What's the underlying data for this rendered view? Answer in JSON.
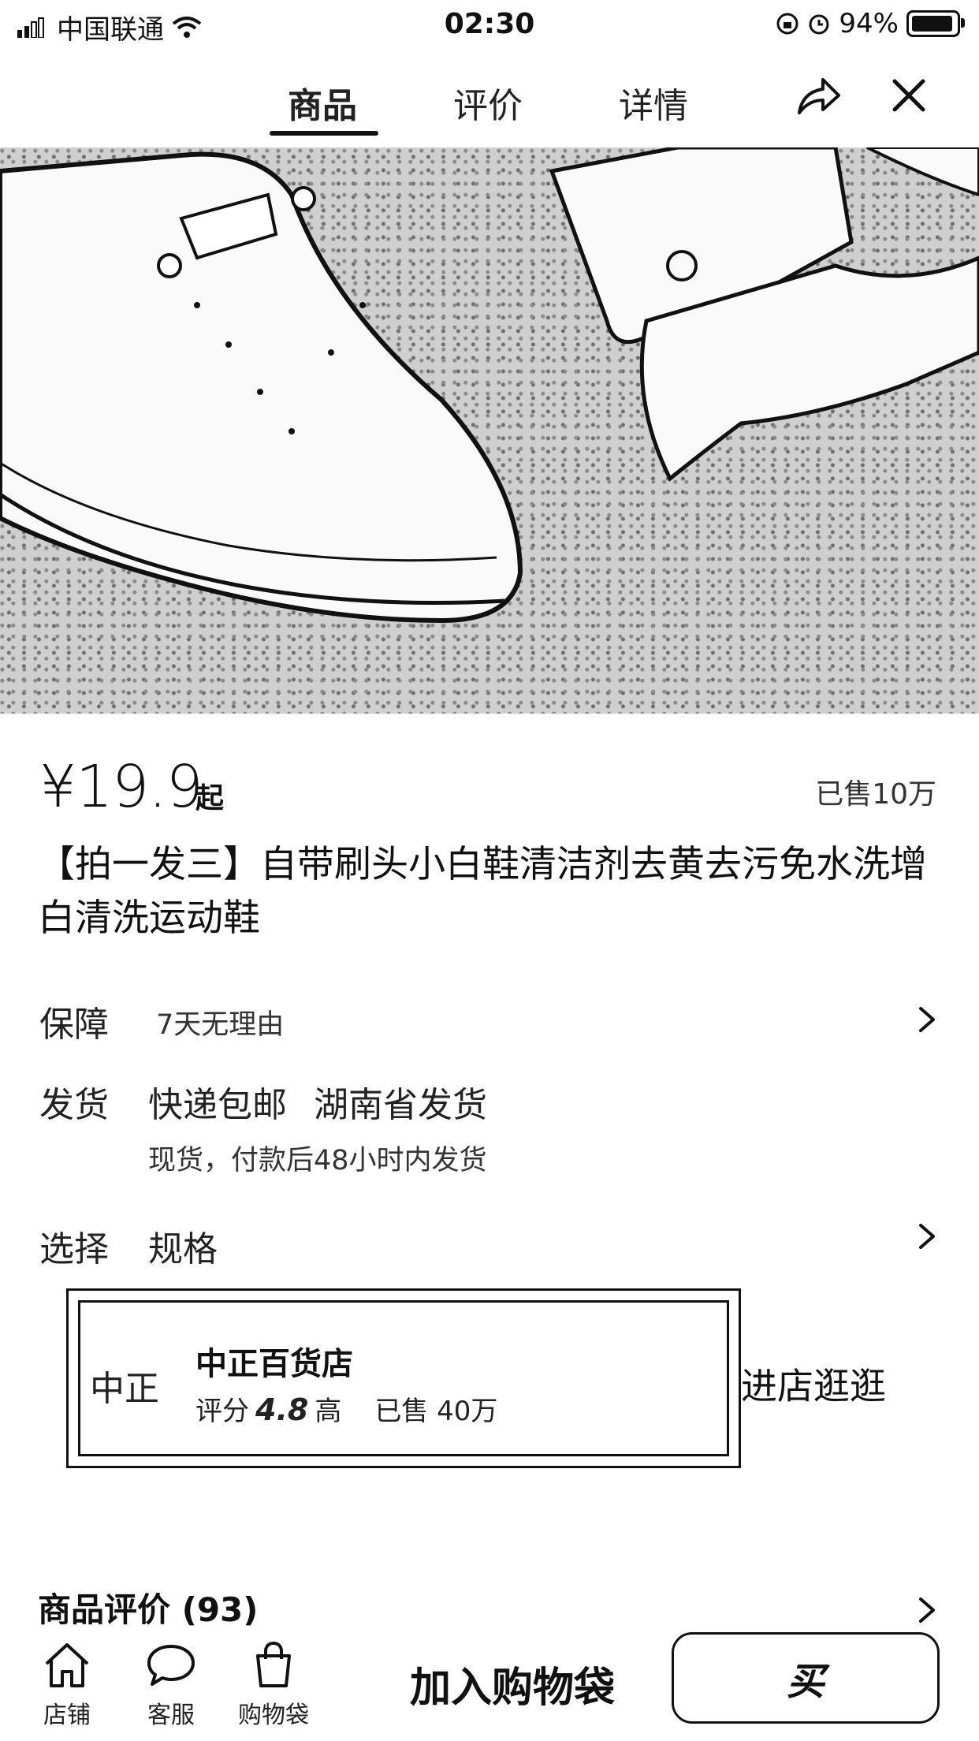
{
  "status_bar": {
    "carrier": "中国联通",
    "time": "02:30",
    "battery": "94%"
  },
  "tabs": [
    {
      "label": "商品"
    },
    {
      "label": "评价"
    },
    {
      "label": "详情"
    }
  ],
  "icons": {
    "share": "share-icon",
    "close": "close-icon",
    "shop": "shop-icon",
    "service": "chat-icon",
    "bag": "bag-icon"
  },
  "product": {
    "price": "¥19.9",
    "price_suffix": "起",
    "sold": "已售10万",
    "title": "【拍一发三】自带刷头小白鞋清洁剂去黄去污免水洗增白清洗运动鞋"
  },
  "guarantee": {
    "label": "保障",
    "value": "7天无理由"
  },
  "shipping": {
    "label": "发货",
    "method": "快递包邮",
    "origin": "湖南省发货",
    "note": "现货，付款后48小时内发货"
  },
  "selection": {
    "label": "选择",
    "value": "规格"
  },
  "shop": {
    "logo_text": "中正",
    "name": "中正百货店",
    "rating_label": "评分",
    "rating": "4.8",
    "rating_level": "高",
    "sold": "已售 40万",
    "visit_label": "进店逛逛"
  },
  "reviews": {
    "label": "商品评价 (93)"
  },
  "bottom_bar": {
    "store": "店铺",
    "service": "客服",
    "bag": "购物袋",
    "add_to_bag": "加入购物袋",
    "buy": "买"
  }
}
